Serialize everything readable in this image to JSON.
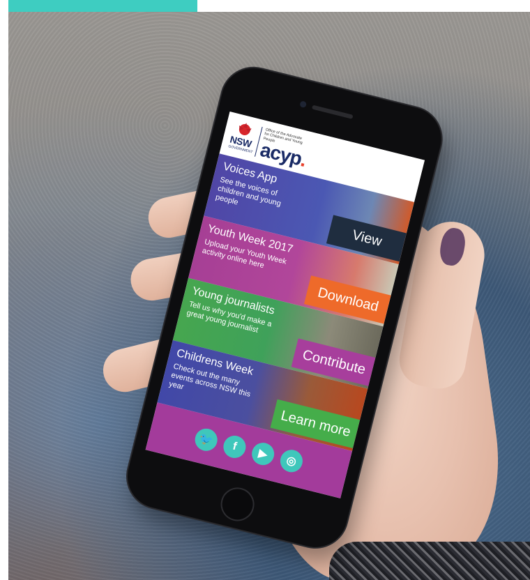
{
  "brand": {
    "gov_logo": "NSW",
    "gov_sub": "GOVERNMENT",
    "office_name": "Office of the Advocate for Children and Young People",
    "app_logo": "acyp",
    "app_logo_dot": "."
  },
  "tiles": [
    {
      "title": "Voices App",
      "description": "See the voices of children and young people",
      "button": "View"
    },
    {
      "title": "Youth Week 2017",
      "description": "Upload your Youth Week activity online here",
      "button": "Download"
    },
    {
      "title": "Young journalists",
      "description": "Tell us why you'd make a great young journalist",
      "button": "Contribute"
    },
    {
      "title": "Childrens Week",
      "description": "Check out the many events across NSW this year",
      "button": "Learn more"
    }
  ],
  "social": [
    {
      "name": "twitter-icon",
      "glyph": "🐦"
    },
    {
      "name": "facebook-icon",
      "glyph": "f"
    },
    {
      "name": "youtube-icon",
      "glyph": "▶"
    },
    {
      "name": "instagram-icon",
      "glyph": "◎"
    }
  ],
  "colors": {
    "accent_teal": "#3ecdc1",
    "purple": "#a33b9b",
    "orange": "#ee6a2a",
    "green": "#45ad4a",
    "navy": "#1f2d3f"
  }
}
